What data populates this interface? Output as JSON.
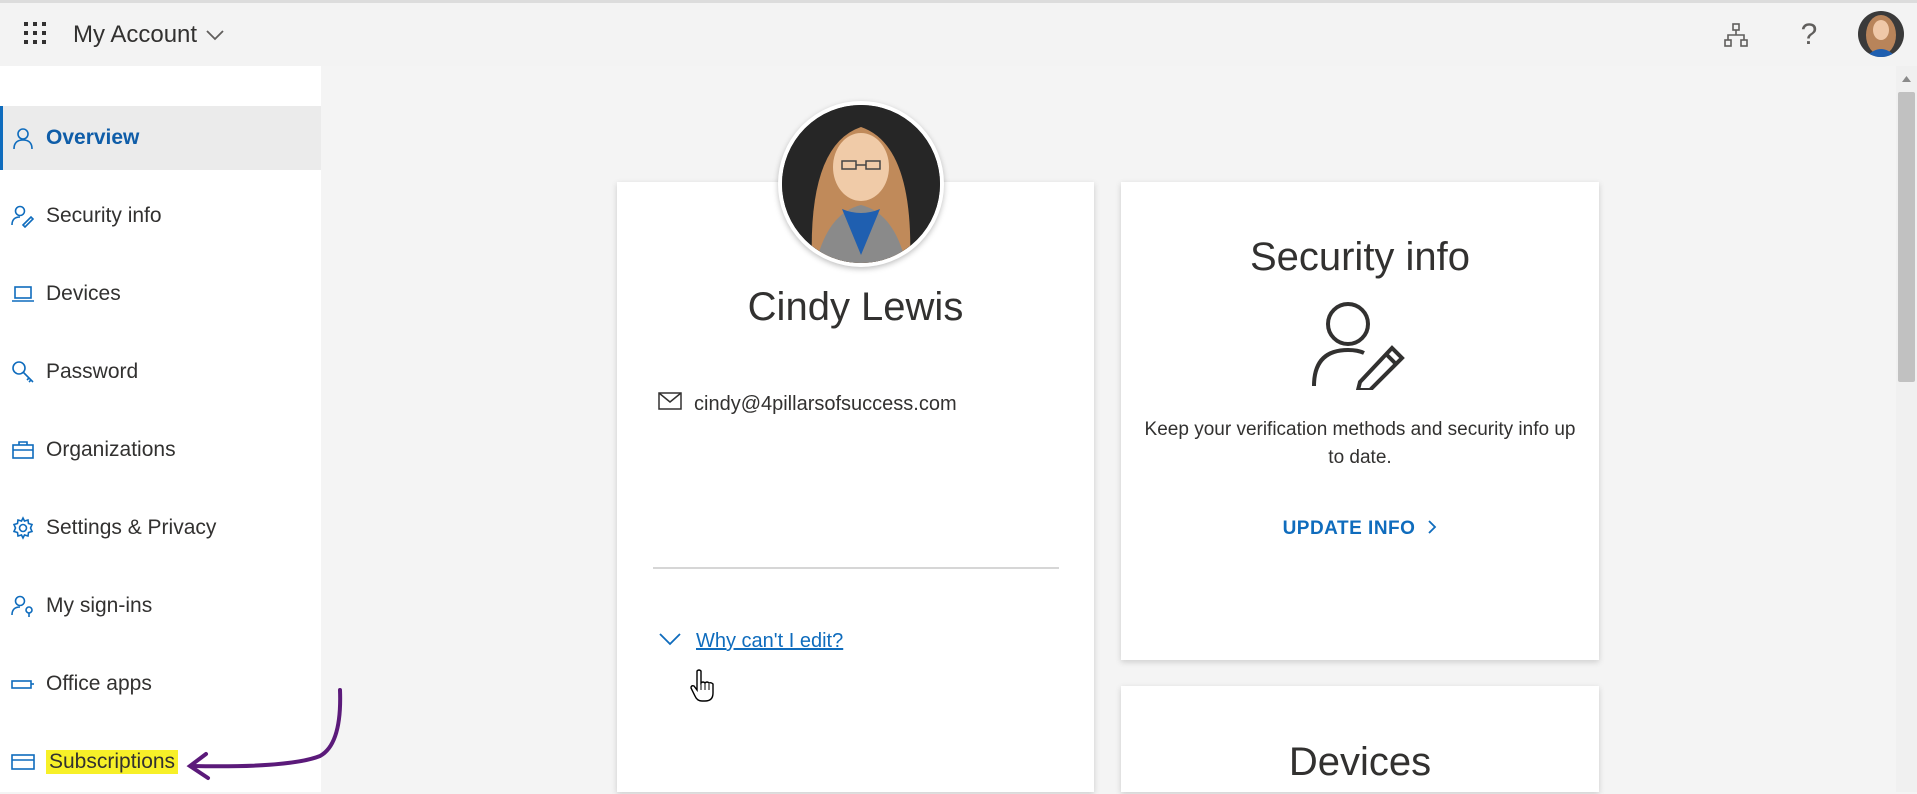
{
  "header": {
    "app_title": "My Account",
    "icons": [
      "waffle-icon",
      "chevron-down-icon",
      "org-chart-icon",
      "help-icon",
      "avatar"
    ],
    "help_glyph": "?"
  },
  "sidebar": {
    "items": [
      {
        "label": "Overview",
        "icon": "person-icon",
        "active": true
      },
      {
        "label": "Security info",
        "icon": "person-key-icon"
      },
      {
        "label": "Devices",
        "icon": "laptop-icon"
      },
      {
        "label": "Password",
        "icon": "key-icon"
      },
      {
        "label": "Organizations",
        "icon": "briefcase-icon"
      },
      {
        "label": "Settings & Privacy",
        "icon": "gear-icon"
      },
      {
        "label": "My sign-ins",
        "icon": "person-key-icon"
      },
      {
        "label": "Office apps",
        "icon": "apps-icon"
      },
      {
        "label": "Subscriptions",
        "icon": "credit-card-icon",
        "highlighted": true
      }
    ]
  },
  "profile": {
    "name": "Cindy Lewis",
    "email": "cindy@4pillarsofsuccess.com",
    "why_link": "Why can't I edit?"
  },
  "security_card": {
    "title": "Security info",
    "description": "Keep your verification methods and security info up to date.",
    "action": "UPDATE INFO"
  },
  "devices_card": {
    "title": "Devices"
  },
  "colors": {
    "accent": "#0f6cbd",
    "highlight": "#f7f028",
    "annotation": "#5b1a7a"
  }
}
